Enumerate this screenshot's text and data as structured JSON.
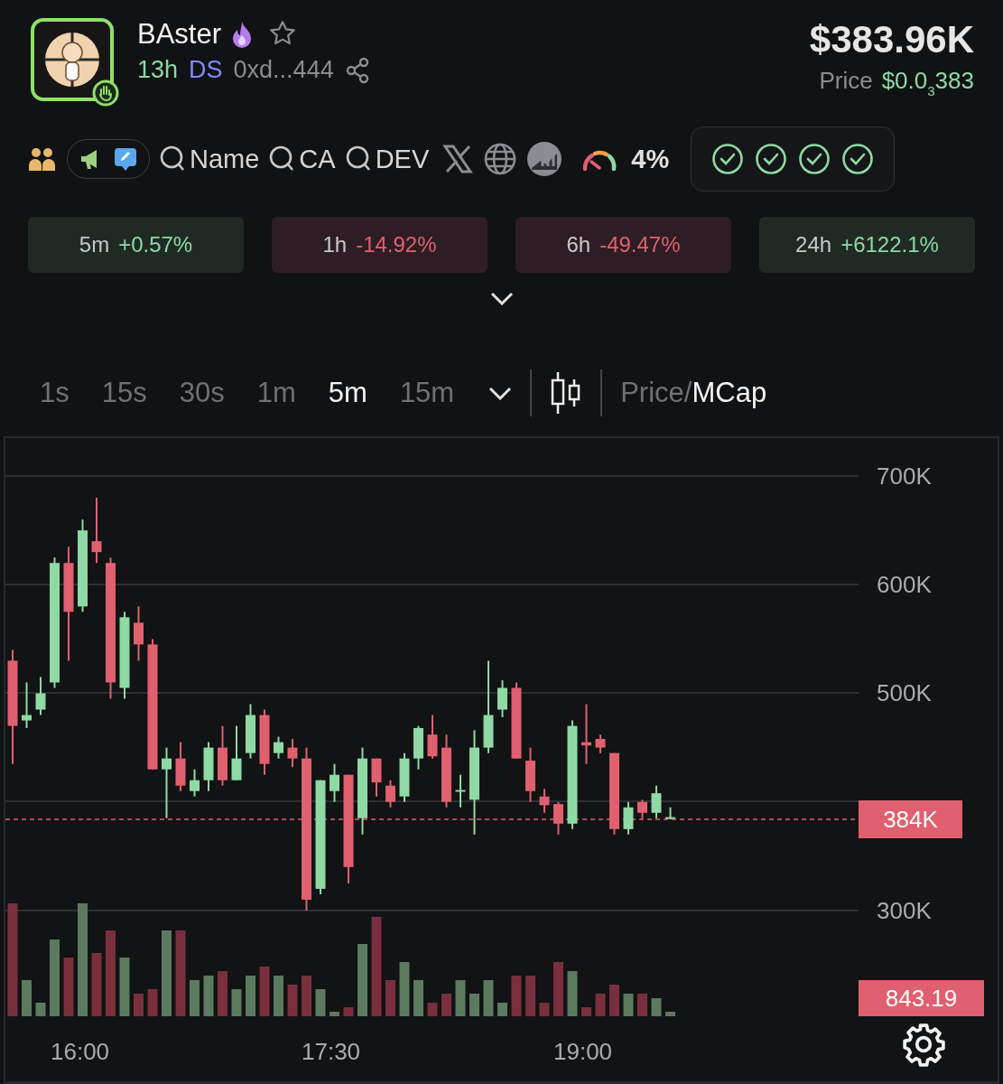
{
  "token": {
    "name": "BAster",
    "hot": true,
    "starred": false,
    "age": "13h",
    "dex": "DS",
    "address": "0xd...444",
    "market_cap": "$383.96K",
    "price_label": "Price",
    "price": "$0.0$_{3}$383"
  },
  "links": {
    "search_links": [
      "Name",
      "CA",
      "DEV"
    ],
    "gauge_reading": "4%"
  },
  "checks": [
    {
      "passed": true
    },
    {
      "passed": true
    },
    {
      "passed": true
    },
    {
      "passed": true
    }
  ],
  "changes": [
    {
      "period": "5m",
      "value": "+0.57%",
      "gain": true
    },
    {
      "period": "1h",
      "value": "-14.92%",
      "gain": false
    },
    {
      "period": "6h",
      "value": "-49.47%",
      "gain": false
    },
    {
      "period": "24h",
      "value": "+6122.1%",
      "gain": true
    }
  ],
  "expanded": false,
  "timeframes": [
    {
      "label": "1s",
      "selected": false
    },
    {
      "label": "15s",
      "selected": false
    },
    {
      "label": "30s",
      "selected": false
    },
    {
      "label": "1m",
      "selected": false
    },
    {
      "label": "5m",
      "selected": true
    },
    {
      "label": "15m",
      "selected": false
    }
  ],
  "mode_separator": "/",
  "mode_toggle": [
    {
      "label": "Price",
      "selected": false
    },
    {
      "label": "MCap",
      "selected": true
    }
  ],
  "chart": {
    "y_labels": [
      "700K",
      "600K",
      "500K",
      "300K"
    ],
    "x_labels": [
      "16:00",
      "17:30",
      "19:00"
    ],
    "price_badge": "384K",
    "volume_badge": "843.19"
  }
}
